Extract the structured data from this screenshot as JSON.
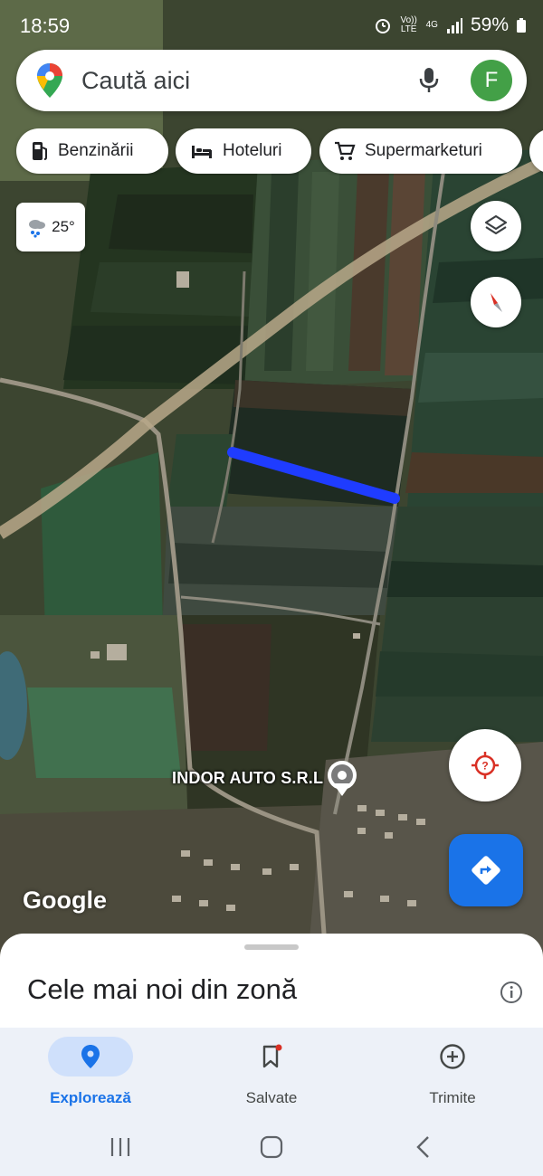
{
  "status_bar": {
    "time": "18:59",
    "volte": "Vo)) LTE",
    "network": "4G",
    "battery": "59%"
  },
  "search": {
    "placeholder": "Caută aici",
    "avatar_letter": "F"
  },
  "chips": [
    {
      "label": "Benzinării",
      "icon": "gas-station-icon"
    },
    {
      "label": "Hoteluri",
      "icon": "bed-icon"
    },
    {
      "label": "Supermarketuri",
      "icon": "shopping-cart-icon"
    }
  ],
  "weather": {
    "temp": "25°",
    "icon": "rain-cloud-icon"
  },
  "map": {
    "place_label": "INDOR AUTO S.R.L",
    "attribution": "Google",
    "drawn_line_color": "#1f3cff"
  },
  "sheet": {
    "title": "Cele mai noi din zonă"
  },
  "bottom_nav": [
    {
      "label": "Explorează",
      "icon": "location-pin-icon",
      "active": true
    },
    {
      "label": "Salvate",
      "icon": "bookmark-icon",
      "active": false
    },
    {
      "label": "Trimite",
      "icon": "add-circle-icon",
      "active": false
    }
  ],
  "colors": {
    "accent": "#1a73e8",
    "directions_fab": "#1a73e8",
    "avatar": "#43a047",
    "location_icon": "#d93025"
  }
}
